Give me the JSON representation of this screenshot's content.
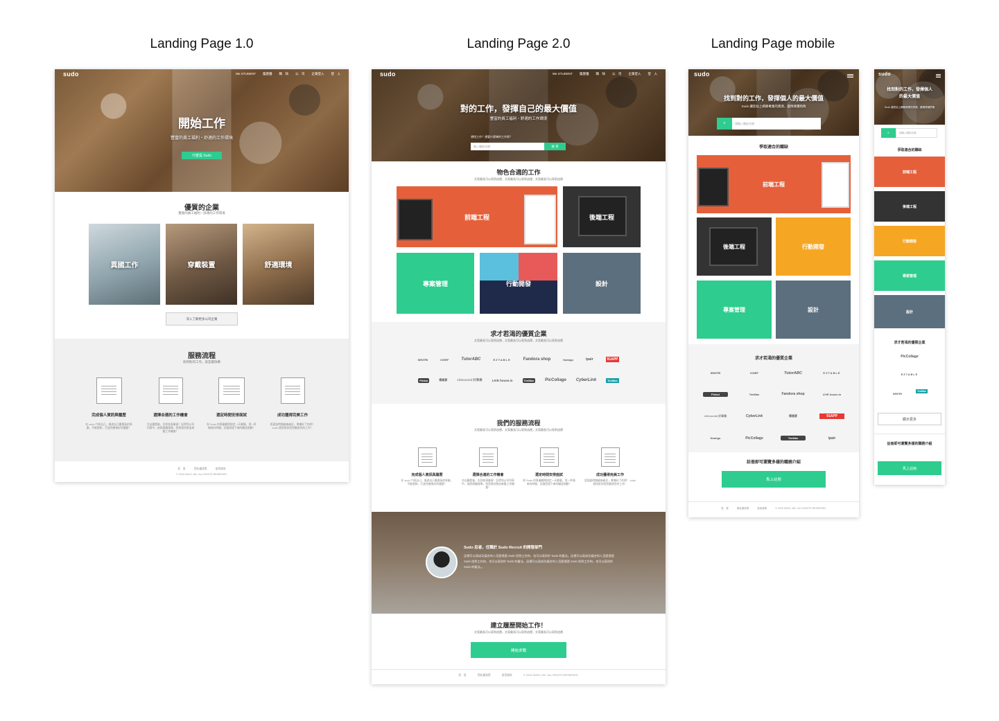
{
  "columns": {
    "v1": "Landing Page 1.0",
    "v2": "Landing Page 2.0",
    "mobile": "Landing Page mobile"
  },
  "brand": "sudo",
  "nav": [
    "We STUDENT",
    "履歷優",
    "職　缺",
    "公　司",
    "企業登入",
    "登　入"
  ],
  "v1": {
    "hero_title": "開始工作",
    "hero_sub": "豐富的員工福利・舒適的工作環境",
    "hero_btn": "什麼是 Sudo",
    "companies_title": "優質的企業",
    "companies_sub": "豐富的員工福利・舒適的工作環境",
    "photos": [
      "異國工作",
      "穿戴裝置",
      "舒適環境"
    ],
    "more_btn": "深入了解更多公司企業",
    "process_title": "服務流程",
    "process_sub": "找到對的工作，就是最快樂"
  },
  "steps": [
    {
      "title": "完成個人資訊與履歷",
      "desc": "在 sudo 介紹自己，描述自己最擅長的專業，不斷更新，打造完善美好的履歷！"
    },
    {
      "title": "選擇合適的工作機會",
      "desc": "交出履歷後，先到各專業頁！記得到公司列表中，依照興趣搜尋，找到適合熱血來襲工作機會！"
    },
    {
      "title": "選定時間安排面試",
      "desc": "與 Sudo 的專業顧問排定一天聊聊，用一杯咖啡的時間，討論您接下來的職涯規劃！"
    },
    {
      "title": "成功獲得完美工作",
      "desc": "距面談時間越來越近，準備好了的吧！ sudo 就快幫你找到最適合的工作！"
    }
  ],
  "footer_links": [
    "首　頁",
    "隱私權政策",
    "使用條款"
  ],
  "copyright": "© 2015 SUDO, INC. ALL RIGHTS RESERVED.",
  "v2": {
    "hero_title": "對的工作，發揮自己的最大價值",
    "hero_sub": "豐富的員工福利・舒適的工作環境",
    "hero_hint": "想找工作？想要什麼樣的工作呢？",
    "search_placeholder": "輸入職缺名稱",
    "search_btn": "搜 尋",
    "jobs_title": "物色合適的工作",
    "jobs_sub": "文案最長可以寫到這裡，文案最長可以寫到這裡，文案最長可以寫到這裡",
    "tiles": [
      "前端工程",
      "後端工程",
      "專案管理",
      "行動開發",
      "設計"
    ],
    "companies_title": "求才若渴的優質企業",
    "companies_sub": "文案最長可以寫到這裡，文案最長可以寫到這裡，文案最長可以寫到這裡",
    "process_title": "我們的服務流程",
    "process_sub": "文案最長可以寫到這裡，文案最長可以寫到這裡，文案最長可以寫到這裡",
    "testimonial_title": "Sudo 忍者，任職於 Sudo Recruit 的開發部門",
    "testimonial_text": "這裡可以寫成功媒合的人怎麼透過 Sudo 找到工作的，也可以寫對於 Sudo 的看法。這裡可以寫成功媒合的人怎麼透過 Sudo 找到工作的，也可以寫對於 Sudo 的看法。這裡可以寫成功媒合的人怎麼透過 Sudo 找到工作的，也可以寫對於 Sudo 的看法。。",
    "cta_title": "建立履歷開始工作！",
    "cta_sub": "文案最長可以寫到這裡，文案最長可以寫到這裡，文案最長可以寫到這裡",
    "cta_btn": "開始求職"
  },
  "logos_row1": [
    "SENTRI",
    "iCHEF",
    "TutorABC",
    "EZTABLE",
    "Fandora shop",
    "Kamigo",
    "ipair",
    "91APP"
  ],
  "logos_row2": [
    "Pinkoi",
    "得易家",
    "citiesocial 好事集",
    "LIVE house.in",
    "TenMax",
    "PicCollage",
    "CyberLink",
    "TenMax"
  ],
  "mobile": {
    "hero_title": "找到對的工作，發揮個人的最大價值",
    "hero_sub": "Sudo 讓您站上網路專業的資源，盡情揮灑熱情",
    "search_placeholder": "請輸入職缺名稱",
    "jobs_title": "爭取適合的職缺",
    "tiles": [
      "前端工程",
      "後端工程",
      "行動開發",
      "專案管理",
      "設計"
    ],
    "companies_title": "求才若渴的優質企業",
    "logos": [
      "SENTRI",
      "iCHEF",
      "TutorABC",
      "EZTABLE",
      "Pinkoi",
      "TenMax",
      "Fandora shop",
      "LIVE house.in",
      "citiesocial 好事集",
      "CyberLink",
      "得易家",
      "91APP",
      "Kamigo",
      "PicCollage",
      "TenMax",
      "ipair"
    ],
    "register_title": "註冊即可瀏覽多樣的職務介紹",
    "register_btn": "馬上註冊"
  },
  "mobile2": {
    "hero_title": "找到對的工作，發揮個人的最大價值",
    "hero_sub": "Sudo 讓您站上網路專業的資源，盡情揮灑熱情",
    "search_placeholder": "請輸入職缺名稱",
    "jobs_title": "爭取適合的職缺",
    "tiles": [
      "前端工程",
      "後端工程",
      "行動開發",
      "專案管理",
      "設計"
    ],
    "companies_title": "求才若渴的優質企業",
    "logos": [
      "PicCollage",
      "EZTABLE",
      "SENTRI",
      "TenMax"
    ],
    "more_btn": "顯示更多",
    "register_title": "註冊即可瀏覽多樣的職務介紹",
    "register_btn": "馬上註冊"
  },
  "colors": {
    "accent_green": "#2ecc8f",
    "tile_orange": "#e5603a",
    "tile_dark": "#333333",
    "tile_blue": "#3d5a80",
    "tile_grey": "#5b6f7e",
    "tile_yellow": "#f5a623"
  }
}
